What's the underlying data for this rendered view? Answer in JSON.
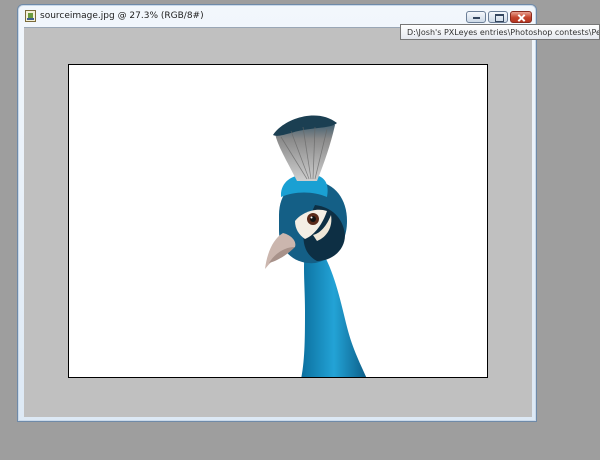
{
  "window": {
    "title": "sourceimage.jpg @ 27.3% (RGB/8#)",
    "controls": {
      "minimize": "minimize",
      "maximize": "maximize",
      "close": "close"
    }
  },
  "tooltip": {
    "text": "D:\\Josh's PXLeyes entries\\Photoshop contests\\Pe"
  },
  "colors": {
    "desktop": "#9e9e9e",
    "canvas_background": "#c0c0c0",
    "document_background": "#ffffff",
    "peacock_blue": "#1f86b5"
  },
  "icons": {
    "document": "document-icon",
    "minimize": "minimize-icon",
    "maximize": "maximize-icon",
    "close": "close-icon"
  }
}
